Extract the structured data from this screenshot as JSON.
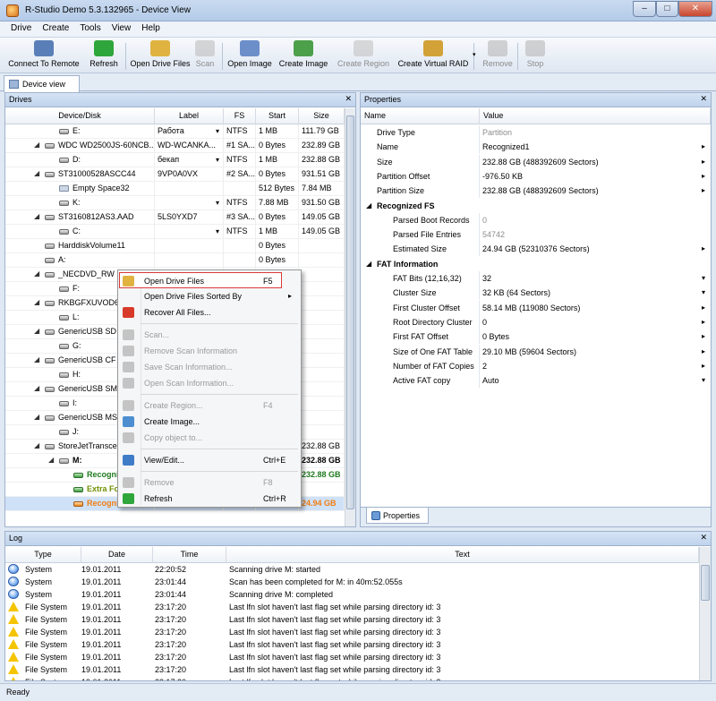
{
  "window": {
    "title": "R-Studio Demo 5.3.132965 - Device View",
    "min": "–",
    "max": "□",
    "close": "✕"
  },
  "menu": [
    "Drive",
    "Create",
    "Tools",
    "View",
    "Help"
  ],
  "toolbar": [
    {
      "label": "Connect To Remote",
      "color": "#5a7fb8",
      "enabled": true
    },
    {
      "label": "Refresh",
      "color": "#2fa63b",
      "enabled": true
    },
    {
      "label": "Open Drive Files",
      "color": "#e0b341",
      "enabled": true
    },
    {
      "label": "Scan",
      "color": "#b8b8b8",
      "enabled": false
    },
    {
      "label": "Open Image",
      "color": "#6c8fc9",
      "enabled": true
    },
    {
      "label": "Create Image",
      "color": "#4ca04a",
      "enabled": true
    },
    {
      "label": "Create Region",
      "color": "#bdbdbd",
      "enabled": false
    },
    {
      "label": "Create Virtual RAID",
      "color": "#d2a239",
      "enabled": true
    },
    {
      "label": "Remove",
      "color": "#b0b0b0",
      "enabled": false
    },
    {
      "label": "Stop",
      "color": "#b0b0b0",
      "enabled": false
    }
  ],
  "tab": "Device view",
  "drives": {
    "title": "Drives",
    "columns": [
      "Device/Disk",
      "Label",
      "FS",
      "Start",
      "Size"
    ],
    "rows": [
      {
        "name": "E:",
        "indent": 2,
        "label": "Работа",
        "fs": "NTFS",
        "start": "1 MB",
        "size": "111.79 GB",
        "icon": "part",
        "arrow": ""
      },
      {
        "name": "WDC WD2500JS-60NCB...",
        "indent": 1,
        "label": "WD-WCANKA...",
        "fs": "#1 SA...",
        "start": "0 Bytes",
        "size": "232.89 GB",
        "icon": "disk",
        "arrow": "◢"
      },
      {
        "name": "D:",
        "indent": 2,
        "label": "бекап",
        "fs": "NTFS",
        "start": "1 MB",
        "size": "232.88 GB",
        "icon": "part",
        "arrow": ""
      },
      {
        "name": "ST31000528ASCC44",
        "indent": 1,
        "label": "9VP0A0VX",
        "fs": "#2 SA...",
        "start": "0 Bytes",
        "size": "931.51 GB",
        "icon": "disk",
        "arrow": "◢"
      },
      {
        "name": "Empty Space32",
        "indent": 2,
        "label": "",
        "fs": "",
        "start": "512 Bytes",
        "size": "7.84 MB",
        "icon": "empty",
        "arrow": ""
      },
      {
        "name": "K:",
        "indent": 2,
        "label": "",
        "fs": "NTFS",
        "start": "7.88 MB",
        "size": "931.50 GB",
        "icon": "part",
        "arrow": ""
      },
      {
        "name": "ST3160812AS3.AAD",
        "indent": 1,
        "label": "5LS0YXD7",
        "fs": "#3 SA...",
        "start": "0 Bytes",
        "size": "149.05 GB",
        "icon": "disk",
        "arrow": "◢"
      },
      {
        "name": "C:",
        "indent": 2,
        "label": "",
        "fs": "NTFS",
        "start": "1 MB",
        "size": "149.05 GB",
        "icon": "part",
        "arrow": ""
      },
      {
        "name": "HarddiskVolume11",
        "indent": 1,
        "label": "",
        "fs": "",
        "start": "0 Bytes",
        "size": "",
        "icon": "disk",
        "arrow": ""
      },
      {
        "name": "A:",
        "indent": 1,
        "label": "",
        "fs": "",
        "start": "0 Bytes",
        "size": "",
        "icon": "part",
        "arrow": ""
      },
      {
        "name": "_NECDVD_RW N",
        "indent": 1,
        "label": "",
        "fs": "",
        "start": "",
        "size": "",
        "icon": "disk",
        "arrow": "◢"
      },
      {
        "name": "F:",
        "indent": 2,
        "label": "",
        "fs": "",
        "start": "",
        "size": "",
        "icon": "part",
        "arrow": ""
      },
      {
        "name": "RKBGFXUVOD6R",
        "indent": 1,
        "label": "",
        "fs": "",
        "start": "",
        "size": "",
        "icon": "disk",
        "arrow": "◢"
      },
      {
        "name": "L:",
        "indent": 2,
        "label": "",
        "fs": "",
        "start": "",
        "size": "",
        "icon": "part",
        "arrow": ""
      },
      {
        "name": "GenericUSB SD R",
        "indent": 1,
        "label": "",
        "fs": "",
        "start": "",
        "size": "",
        "icon": "disk",
        "arrow": "◢"
      },
      {
        "name": "G:",
        "indent": 2,
        "label": "",
        "fs": "",
        "start": "",
        "size": "",
        "icon": "part",
        "arrow": ""
      },
      {
        "name": "GenericUSB CF R",
        "indent": 1,
        "label": "",
        "fs": "",
        "start": "",
        "size": "",
        "icon": "disk",
        "arrow": "◢"
      },
      {
        "name": "H:",
        "indent": 2,
        "label": "",
        "fs": "",
        "start": "",
        "size": "",
        "icon": "part",
        "arrow": ""
      },
      {
        "name": "GenericUSB SM F",
        "indent": 1,
        "label": "",
        "fs": "",
        "start": "",
        "size": "",
        "icon": "disk",
        "arrow": "◢"
      },
      {
        "name": "I:",
        "indent": 2,
        "label": "",
        "fs": "",
        "start": "",
        "size": "",
        "icon": "part",
        "arrow": ""
      },
      {
        "name": "GenericUSB MS F",
        "indent": 1,
        "label": "",
        "fs": "",
        "start": "",
        "size": "",
        "icon": "disk",
        "arrow": "◢"
      },
      {
        "name": "J:",
        "indent": 2,
        "label": "",
        "fs": "",
        "start": "",
        "size": "",
        "icon": "part",
        "arrow": ""
      },
      {
        "name": "StoreJetTranscen",
        "indent": 1,
        "label": "",
        "fs": "",
        "start": "",
        "size": "232.88 GB",
        "icon": "disk",
        "arrow": "◢"
      },
      {
        "name": "M:",
        "indent": 2,
        "label": "",
        "fs": "",
        "start": "",
        "size": "232.88 GB",
        "icon": "part",
        "arrow": "◢",
        "bold": true
      },
      {
        "name": "Recognizd",
        "indent": 3,
        "label": "",
        "fs": "",
        "start": "",
        "size": "232.88 GB",
        "icon": "green",
        "arrow": "",
        "color": "#1f7a1f",
        "bold": true
      },
      {
        "name": "Extra Fou",
        "indent": 3,
        "label": "",
        "fs": "",
        "start": "",
        "size": "",
        "icon": "green",
        "arrow": "",
        "color": "#6f8f00",
        "bold": true
      },
      {
        "name": "Recognized1",
        "indent": 3,
        "label": "",
        "fs": "FAT32",
        "start": "",
        "size": "24.94 GB",
        "icon": "orange",
        "arrow": "",
        "color": "#f07e12",
        "bold": true,
        "selected": true
      }
    ]
  },
  "context_menu": [
    {
      "label": "Open Drive Files",
      "shortcut": "F5",
      "enabled": true,
      "highlight": true,
      "icon": "#e0b341"
    },
    {
      "label": "Open Drive Files Sorted By",
      "shortcut": "",
      "enabled": true,
      "submenu": true,
      "icon": ""
    },
    {
      "label": "Recover All Files...",
      "shortcut": "",
      "enabled": true,
      "icon": "#d73a2a"
    },
    {
      "sep": true
    },
    {
      "label": "Scan...",
      "shortcut": "",
      "enabled": false,
      "icon": "#c4c4c4"
    },
    {
      "label": "Remove Scan Information",
      "shortcut": "",
      "enabled": false,
      "icon": "#c4c4c4"
    },
    {
      "label": "Save Scan Information...",
      "shortcut": "",
      "enabled": false,
      "icon": "#c4c4c4"
    },
    {
      "label": "Open Scan Information...",
      "shortcut": "",
      "enabled": false,
      "icon": "#c4c4c4"
    },
    {
      "sep": true
    },
    {
      "label": "Create Region...",
      "shortcut": "F4",
      "enabled": false,
      "icon": "#c4c4c4"
    },
    {
      "label": "Create Image...",
      "shortcut": "",
      "enabled": true,
      "icon": "#4c8ed0"
    },
    {
      "label": "Copy object to...",
      "shortcut": "",
      "enabled": false,
      "icon": "#c4c4c4"
    },
    {
      "sep": true
    },
    {
      "label": "View/Edit...",
      "shortcut": "Ctrl+E",
      "enabled": true,
      "icon": "#3f7cc7"
    },
    {
      "sep": true
    },
    {
      "label": "Remove",
      "shortcut": "F8",
      "enabled": false,
      "icon": "#c4c4c4"
    },
    {
      "label": "Refresh",
      "shortcut": "Ctrl+R",
      "enabled": true,
      "icon": "#2fa63b"
    }
  ],
  "properties": {
    "title": "Properties",
    "columns": [
      "Name",
      "Value"
    ],
    "tab": "Properties",
    "rows": [
      {
        "name": "Drive Type",
        "value": "Partition",
        "gray": true
      },
      {
        "name": "Name",
        "value": "Recognized1",
        "more": "▸"
      },
      {
        "name": "Size",
        "value": "232.88 GB (488392609 Sectors)",
        "more": "▸"
      },
      {
        "name": "Partition Offset",
        "value": "-976.50 KB",
        "more": "▸"
      },
      {
        "name": "Partition Size",
        "value": "232.88 GB (488392609 Sectors)",
        "more": "▸"
      },
      {
        "group": true,
        "name": "Recognized FS"
      },
      {
        "name": "Parsed Boot Records",
        "value": "0",
        "gray": true,
        "sub": true
      },
      {
        "name": "Parsed File Entries",
        "value": "54742",
        "gray": true,
        "sub": true
      },
      {
        "name": "Estimated Size",
        "value": "24.94 GB (52310376 Sectors)",
        "sub": true,
        "more": "▸"
      },
      {
        "group": true,
        "name": "FAT Information"
      },
      {
        "name": "FAT Bits (12,16,32)",
        "value": "32",
        "sub": true,
        "more": "▾"
      },
      {
        "name": "Cluster Size",
        "value": "32 KB (64 Sectors)",
        "sub": true,
        "more": "▾"
      },
      {
        "name": "First Cluster Offset",
        "value": "58.14 MB (119080 Sectors)",
        "sub": true,
        "more": "▸"
      },
      {
        "name": "Root Directory Cluster",
        "value": "0",
        "sub": true,
        "more": "▸"
      },
      {
        "name": "First FAT Offset",
        "value": "0 Bytes",
        "sub": true,
        "more": "▸"
      },
      {
        "name": "Size of One FAT Table",
        "value": "29.10 MB (59604 Sectors)",
        "sub": true,
        "more": "▸"
      },
      {
        "name": "Number of FAT Copies",
        "value": "2",
        "sub": true,
        "more": "▸"
      },
      {
        "name": "Active FAT copy",
        "value": "Auto",
        "sub": true,
        "more": "▾"
      }
    ]
  },
  "log": {
    "title": "Log",
    "columns": [
      "Type",
      "Date",
      "Time",
      "Text"
    ],
    "rows": [
      {
        "level": "info",
        "type": "System",
        "date": "19.01.2011",
        "time": "22:20:52",
        "text": "Scanning drive M: started"
      },
      {
        "level": "info",
        "type": "System",
        "date": "19.01.2011",
        "time": "23:01:44",
        "text": "Scan has been completed for M: in 40m:52.055s"
      },
      {
        "level": "info",
        "type": "System",
        "date": "19.01.2011",
        "time": "23:01:44",
        "text": "Scanning drive M: completed"
      },
      {
        "level": "warn",
        "type": "File System",
        "date": "19.01.2011",
        "time": "23:17:20",
        "text": "Last lfn slot haven't last flag set while parsing directory id: 3"
      },
      {
        "level": "warn",
        "type": "File System",
        "date": "19.01.2011",
        "time": "23:17:20",
        "text": "Last lfn slot haven't last flag set while parsing directory id: 3"
      },
      {
        "level": "warn",
        "type": "File System",
        "date": "19.01.2011",
        "time": "23:17:20",
        "text": "Last lfn slot haven't last flag set while parsing directory id: 3"
      },
      {
        "level": "warn",
        "type": "File System",
        "date": "19.01.2011",
        "time": "23:17:20",
        "text": "Last lfn slot haven't last flag set while parsing directory id: 3"
      },
      {
        "level": "warn",
        "type": "File System",
        "date": "19.01.2011",
        "time": "23:17:20",
        "text": "Last lfn slot haven't last flag set while parsing directory id: 3"
      },
      {
        "level": "warn",
        "type": "File System",
        "date": "19.01.2011",
        "time": "23:17:20",
        "text": "Last lfn slot haven't last flag set while parsing directory id: 3"
      },
      {
        "level": "warn",
        "type": "File System",
        "date": "19.01.2011",
        "time": "23:17:20",
        "text": "Last lfn slot haven't last flag set while parsing directory id: 3"
      }
    ]
  },
  "status": "Ready",
  "close_glyph": "✕"
}
